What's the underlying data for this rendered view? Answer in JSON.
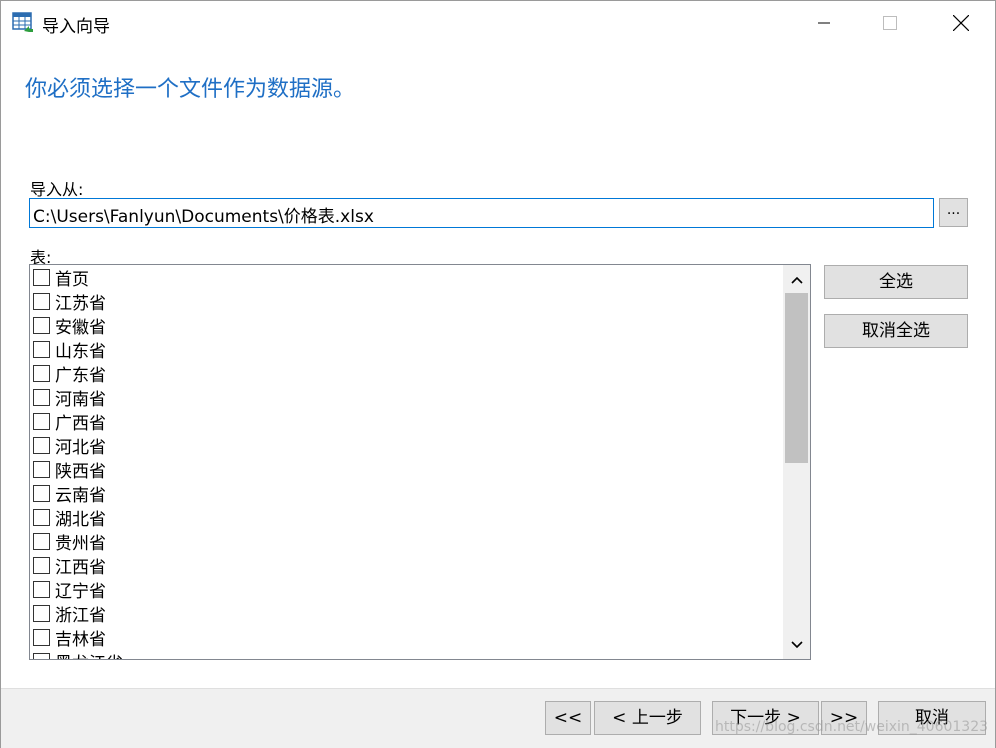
{
  "window": {
    "title": "导入向导",
    "app_icon": "table-import-icon",
    "controls": [
      "minimize-icon",
      "maximize-icon",
      "close-icon"
    ]
  },
  "heading": "你必须选择一个文件作为数据源。",
  "import_from": {
    "label": "导入从:",
    "value": "C:\\Users\\Fanlyun\\Documents\\价格表.xlsx",
    "browse_label": "..."
  },
  "tables": {
    "label": "表:",
    "items": [
      {
        "label": "首页",
        "checked": false
      },
      {
        "label": "江苏省",
        "checked": false
      },
      {
        "label": "安徽省",
        "checked": false
      },
      {
        "label": "山东省",
        "checked": false
      },
      {
        "label": "广东省",
        "checked": false
      },
      {
        "label": "河南省",
        "checked": false
      },
      {
        "label": "广西省",
        "checked": false
      },
      {
        "label": "河北省",
        "checked": false
      },
      {
        "label": "陕西省",
        "checked": false
      },
      {
        "label": "云南省",
        "checked": false
      },
      {
        "label": "湖北省",
        "checked": false
      },
      {
        "label": "贵州省",
        "checked": false
      },
      {
        "label": "江西省",
        "checked": false
      },
      {
        "label": "辽宁省",
        "checked": false
      },
      {
        "label": "浙江省",
        "checked": false
      },
      {
        "label": "吉林省",
        "checked": false
      },
      {
        "label": "黑龙江省",
        "checked": false
      }
    ]
  },
  "side_buttons": {
    "select_all": "全选",
    "deselect_all": "取消全选"
  },
  "nav_buttons": {
    "first": "<<",
    "prev": "< 上一步",
    "next": "下一步 >",
    "last": ">>",
    "cancel": "取消"
  },
  "watermark": "https://blog.csdn.net/weixin_40601323",
  "colors": {
    "heading": "#1f6fc5",
    "input_focus_border": "#0078d7",
    "button_bg": "#e1e1e1",
    "bottom_bar_bg": "#f0f0f0"
  }
}
